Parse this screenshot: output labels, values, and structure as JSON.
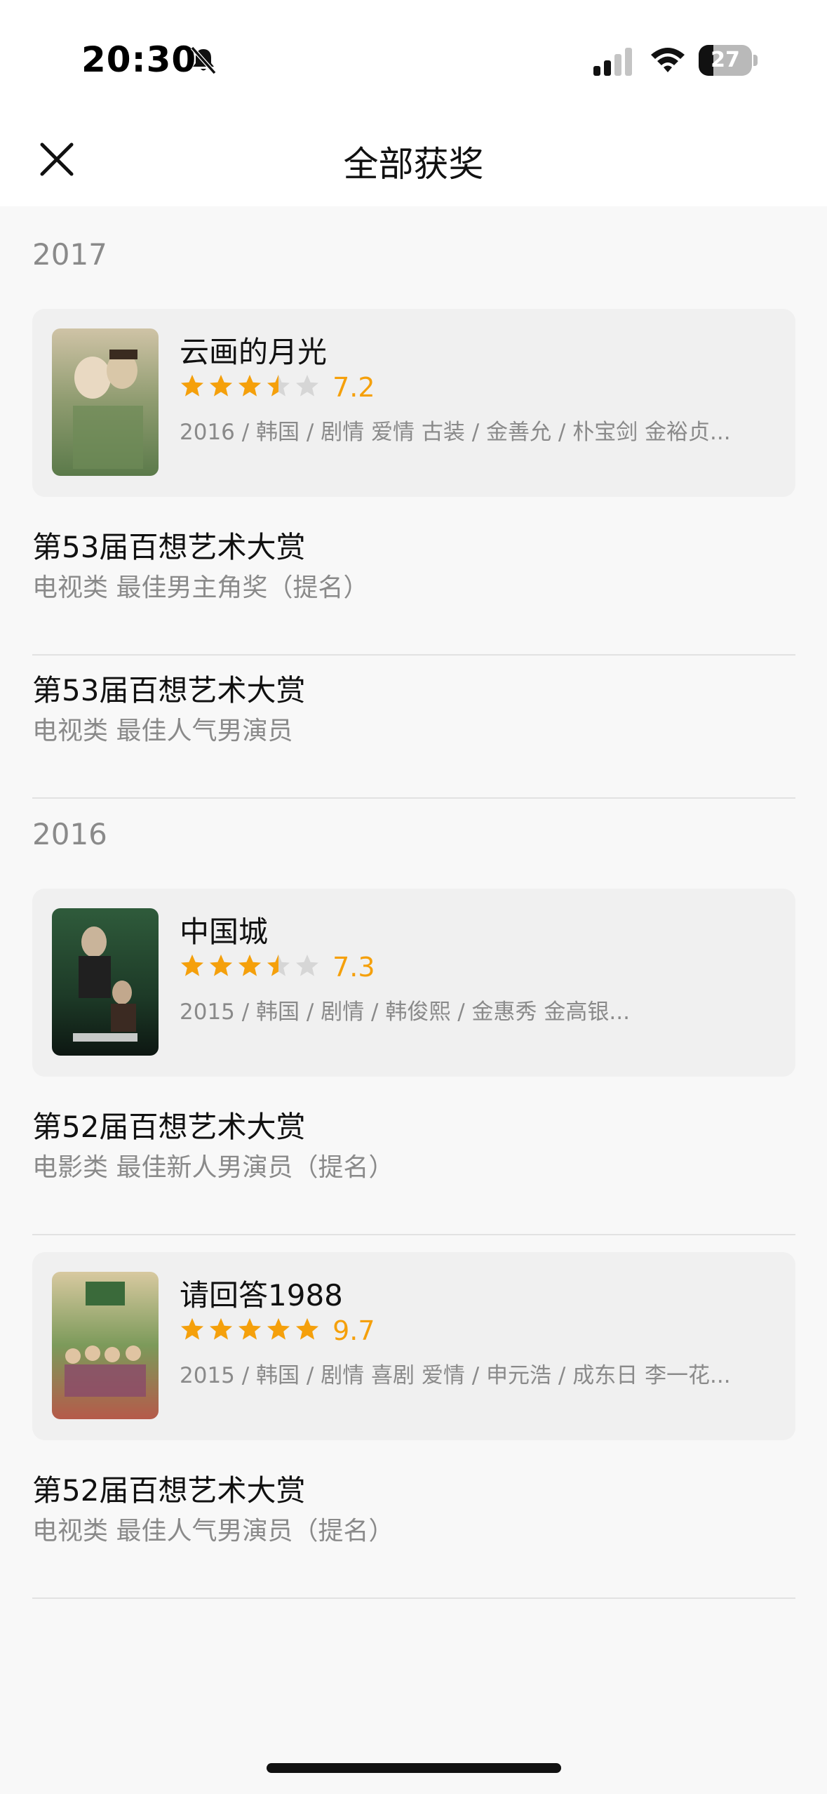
{
  "status_bar": {
    "time": "20:30",
    "battery": "27",
    "battery_level": 0.27
  },
  "nav": {
    "title": "全部获奖"
  },
  "sections": [
    {
      "year": "2017",
      "works": [
        {
          "title": "云画的月光",
          "rating": 7.2,
          "rating_text": "7.2",
          "stars": 3.5,
          "meta": "2016 / 韩国 / 剧情 爱情 古装 / 金善允 / 朴宝剑 金裕贞...",
          "poster_colors": [
            "#cfc3a6",
            "#5b7a4a",
            "#8e9b6f"
          ],
          "awards": [
            {
              "title": "第53届百想艺术大赏",
              "sub": "电视类 最佳男主角奖（提名）"
            },
            {
              "title": "第53届百想艺术大赏",
              "sub": "电视类 最佳人气男演员"
            }
          ]
        }
      ]
    },
    {
      "year": "2016",
      "works": [
        {
          "title": "中国城",
          "rating": 7.3,
          "rating_text": "7.3",
          "stars": 3.5,
          "meta": "2015 / 韩国 / 剧情 / 韩俊熙 / 金惠秀 金高银...",
          "poster_colors": [
            "#1d3a27",
            "#2f5b3b",
            "#0d1712"
          ],
          "awards": [
            {
              "title": "第52届百想艺术大赏",
              "sub": "电影类 最佳新人男演员（提名）"
            }
          ]
        },
        {
          "title": "请回答1988",
          "rating": 9.7,
          "rating_text": "9.7",
          "stars": 5,
          "meta": "2015 / 韩国 / 剧情 喜剧 爱情 / 申元浩 / 成东日 李一花...",
          "poster_colors": [
            "#d8c9a0",
            "#7c9a5a",
            "#b55a4a"
          ],
          "awards": [
            {
              "title": "第52届百想艺术大赏",
              "sub": "电视类 最佳人气男演员（提名）"
            }
          ]
        }
      ]
    }
  ],
  "colors": {
    "star": "#f5a00b",
    "star_empty": "#d6d6d6",
    "accent": "#f5a00b"
  }
}
